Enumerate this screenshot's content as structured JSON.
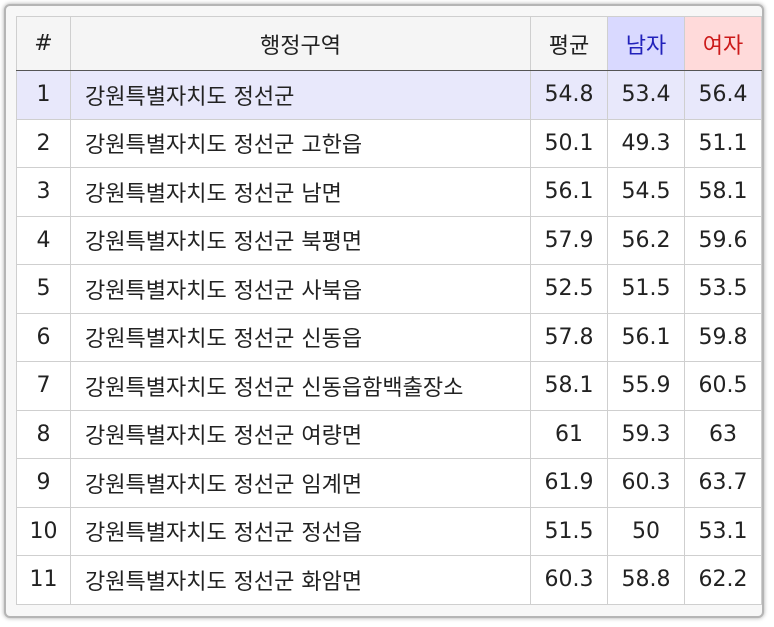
{
  "table": {
    "headers": {
      "num": "#",
      "region": "행정구역",
      "avg": "평균",
      "male": "남자",
      "female": "여자"
    },
    "rows": [
      {
        "num": "1",
        "region": "강원특별자치도 정선군",
        "avg": "54.8",
        "male": "53.4",
        "female": "56.4"
      },
      {
        "num": "2",
        "region": "강원특별자치도 정선군 고한읍",
        "avg": "50.1",
        "male": "49.3",
        "female": "51.1"
      },
      {
        "num": "3",
        "region": "강원특별자치도 정선군 남면",
        "avg": "56.1",
        "male": "54.5",
        "female": "58.1"
      },
      {
        "num": "4",
        "region": "강원특별자치도 정선군 북평면",
        "avg": "57.9",
        "male": "56.2",
        "female": "59.6"
      },
      {
        "num": "5",
        "region": "강원특별자치도 정선군 사북읍",
        "avg": "52.5",
        "male": "51.5",
        "female": "53.5"
      },
      {
        "num": "6",
        "region": "강원특별자치도 정선군 신동읍",
        "avg": "57.8",
        "male": "56.1",
        "female": "59.8"
      },
      {
        "num": "7",
        "region": "강원특별자치도 정선군 신동읍함백출장소",
        "avg": "58.1",
        "male": "55.9",
        "female": "60.5"
      },
      {
        "num": "8",
        "region": "강원특별자치도 정선군 여량면",
        "avg": "61",
        "male": "59.3",
        "female": "63"
      },
      {
        "num": "9",
        "region": "강원특별자치도 정선군 임계면",
        "avg": "61.9",
        "male": "60.3",
        "female": "63.7"
      },
      {
        "num": "10",
        "region": "강원특별자치도 정선군 정선읍",
        "avg": "51.5",
        "male": "50",
        "female": "53.1"
      },
      {
        "num": "11",
        "region": "강원특별자치도 정선군 화암면",
        "avg": "60.3",
        "male": "58.8",
        "female": "62.2"
      }
    ]
  },
  "colors": {
    "male_header_bg": "#d9d9ff",
    "male_header_text": "#2222bb",
    "female_header_bg": "#ffdada",
    "female_header_text": "#cc1a1a",
    "highlight_row_bg": "#e8e8fb"
  }
}
